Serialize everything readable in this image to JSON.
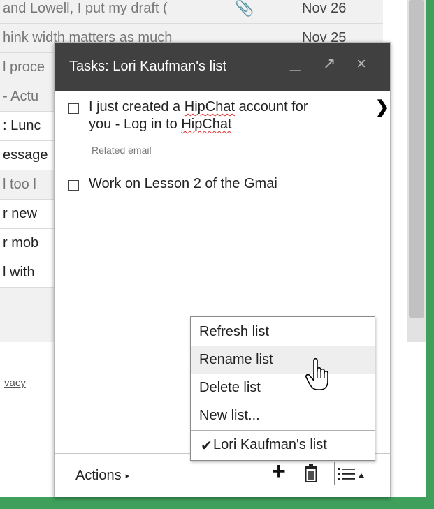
{
  "inbox": {
    "rows": [
      {
        "snippet": "and Lowell, I put my draft (",
        "date": "Nov 26",
        "state": "read",
        "clip": true
      },
      {
        "snippet": "hink width matters as much",
        "date": "Nov 25",
        "state": "read",
        "clip": false
      },
      {
        "snippet": "l proce",
        "date": "",
        "state": "read",
        "clip": false
      },
      {
        "snippet": "- Actu",
        "date": "",
        "state": "read",
        "clip": false
      },
      {
        "snippet": ": Lunc",
        "date": "",
        "state": "unread",
        "clip": false
      },
      {
        "snippet": "essage",
        "date": "",
        "state": "unread",
        "clip": false
      },
      {
        "snippet": "l too l",
        "date": "",
        "state": "read",
        "clip": false
      },
      {
        "snippet": "r new",
        "date": "",
        "state": "unread",
        "clip": false
      },
      {
        "snippet": "r mob",
        "date": "",
        "state": "unread",
        "clip": false
      },
      {
        "snippet": "l with",
        "date": "",
        "state": "unread",
        "clip": false
      }
    ],
    "privacy_link": "vacy"
  },
  "tasks_panel": {
    "title": "Tasks: Lori Kaufman's list",
    "minimize_glyph": "_",
    "popout_glyph": "↗",
    "close_glyph": "×",
    "tasks": [
      {
        "line1_prefix": "I just created a ",
        "line1_sq": "HipChat",
        "line1_suffix": " account for",
        "line2_prefix": "you - Log in to ",
        "line2_sq": "HipChat",
        "related": "Related email"
      },
      {
        "text": "Work on Lesson 2 of the Gmai"
      }
    ],
    "footer": {
      "actions_label": "Actions",
      "actions_arrow": "▸",
      "add_glyph": "+"
    }
  },
  "menu": {
    "items": [
      "Refresh list",
      "Rename list",
      "Delete list",
      "New list..."
    ],
    "hovered_item": "Rename list",
    "lists": [
      {
        "label": "Lori Kaufman's list",
        "checked": true
      }
    ],
    "check_glyph": "✔"
  },
  "colors": {
    "header_bg": "#404040",
    "accent_green": "#3fa05c",
    "spellcheck_red": "#e03030"
  }
}
